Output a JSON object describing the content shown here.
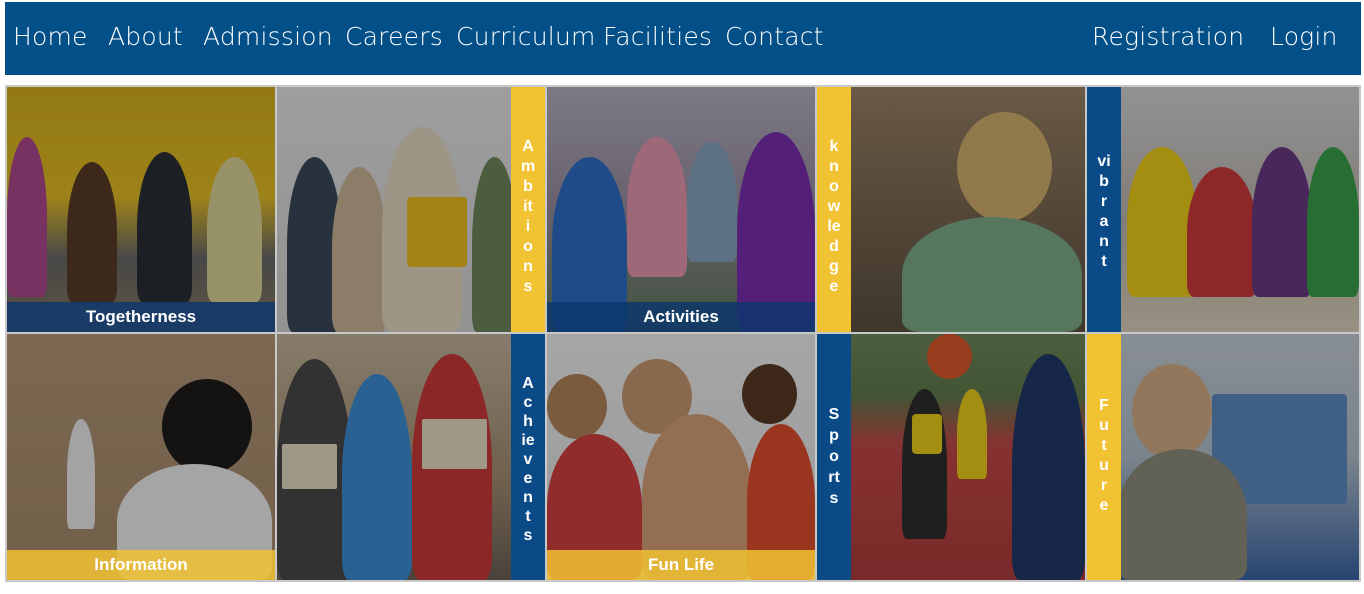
{
  "nav": {
    "left": [
      "Home",
      "About",
      "Admission",
      "Careers",
      "Curriculum",
      "Facilities",
      "Contact"
    ],
    "right": [
      "Registration",
      "Login"
    ]
  },
  "colors": {
    "nav_bg": "#034f87",
    "blue_strip": "#0a4a86",
    "gold_strip": "#f1c232",
    "grid_border": "#c8c8c8"
  },
  "tiles": {
    "togetherness": "Togetherness",
    "ambitions": "Ambitions",
    "activities": "Activities",
    "knowledge": "knowledge",
    "vibrant": "vibrant",
    "information": "Information",
    "achievents": "Achievents",
    "funlife": "Fun Life",
    "sports": "Sports",
    "future": "Future"
  }
}
